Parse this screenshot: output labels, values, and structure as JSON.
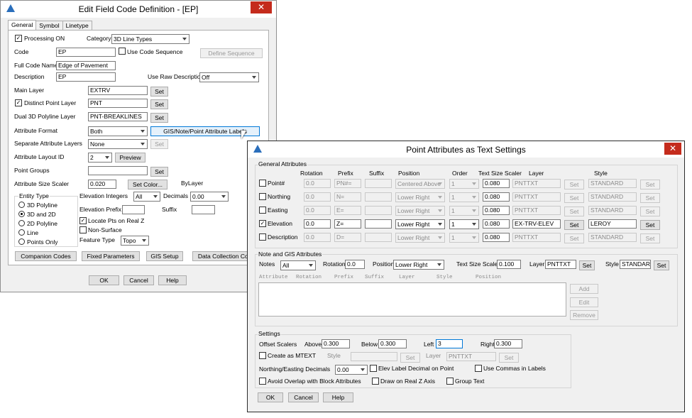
{
  "w1": {
    "title": "Edit Field Code Definition - [EP]",
    "close": "✕",
    "tabs": [
      "General",
      "Symbol",
      "Linetype"
    ],
    "processing_on": "Processing ON",
    "category_label": "Category",
    "category_value": "3D Line Types",
    "code_label": "Code",
    "code_value": "EP",
    "use_code_seq": "Use Code Sequence",
    "define_seq": "Define Sequence",
    "full_code_label": "Full Code Name",
    "full_code_value": "Edge of Pavement",
    "desc_label": "Description",
    "desc_value": "EP",
    "use_raw_label": "Use Raw Description",
    "use_raw_value": "Off",
    "main_layer_label": "Main Layer",
    "main_layer_value": "EXTRV",
    "distinct_label": "Distinct Point Layer",
    "distinct_value": "PNT",
    "dual_label": "Dual 3D Polyline Layer",
    "dual_value": "PNT-BREAKLINES",
    "attr_format_label": "Attribute Format",
    "attr_format_value": "Both",
    "gis_labels_btn": "GIS/Note/Point Attribute Labels",
    "sep_attr_label": "Separate Attribute Layers",
    "sep_attr_value": "None",
    "attr_layout_label": "Attribute Layout ID",
    "attr_layout_value": "2",
    "preview": "Preview",
    "point_groups_label": "Point Groups",
    "point_groups_value": "",
    "attr_size_label": "Attribute Size Scaler",
    "attr_size_value": "0.020",
    "set_color": "Set Color...",
    "bylayer": "ByLayer",
    "set": "Set",
    "entity_type": "Entity Type",
    "entity_options": [
      "3D Polyline",
      "3D and 2D",
      "2D Polyline",
      "Line",
      "Points Only"
    ],
    "elev_int_label": "Elevation Integers",
    "elev_int_value": "All",
    "decimals_label": "Decimals",
    "decimals_value": "0.00",
    "elev_prefix_label": "Elevation Prefix",
    "elev_prefix_value": "",
    "suffix_label": "Suffix",
    "suffix_value": "",
    "locate_pts": "Locate Pts on Real Z",
    "non_surface": "Non-Surface",
    "feature_type_label": "Feature Type",
    "feature_type_value": "Topo",
    "bottom_buttons": [
      "Companion Codes",
      "Fixed Parameters",
      "GIS Setup",
      "Data Collection Code"
    ],
    "ok": "OK",
    "cancel": "Cancel",
    "help": "Help"
  },
  "w2": {
    "title": "Point Attributes as Text Settings",
    "close": "✕",
    "general_attrs": "General Attributes",
    "headers": [
      "Rotation",
      "Prefix",
      "Suffix",
      "Position",
      "Order",
      "Text Size Scaler",
      "Layer",
      "Style"
    ],
    "rows": [
      {
        "name": "Point#",
        "checked": false,
        "rotation": "0.0",
        "prefix": "PN#=",
        "suffix": "",
        "position": "Centered Above",
        "order": "1",
        "size": "0.080",
        "layer": "PNTTXT",
        "style": "STANDARD"
      },
      {
        "name": "Northing",
        "checked": false,
        "rotation": "0.0",
        "prefix": "N=",
        "suffix": "",
        "position": "Lower Right",
        "order": "1",
        "size": "0.080",
        "layer": "PNTTXT",
        "style": "STANDARD"
      },
      {
        "name": "Easting",
        "checked": false,
        "rotation": "0.0",
        "prefix": "E=",
        "suffix": "",
        "position": "Lower Right",
        "order": "1",
        "size": "0.080",
        "layer": "PNTTXT",
        "style": "STANDARD"
      },
      {
        "name": "Elevation",
        "checked": true,
        "rotation": "0.0",
        "prefix": "Z=",
        "suffix": "",
        "position": "Lower Right",
        "order": "1",
        "size": "0.080",
        "layer": "EX-TRV-ELEV",
        "style": "LEROY"
      },
      {
        "name": "Description",
        "checked": false,
        "rotation": "0.0",
        "prefix": "D=",
        "suffix": "",
        "position": "Lower Right",
        "order": "1",
        "size": "0.080",
        "layer": "PNTTXT",
        "style": "STANDARD"
      }
    ],
    "set": "Set",
    "note_gis": "Note and GIS Attributes",
    "notes_label": "Notes",
    "notes_value": "All",
    "rotation_label": "Rotation",
    "rotation_value": "0.0",
    "position_label": "Position",
    "position_value": "Lower Right",
    "tss_label": "Text Size Scaler",
    "tss_value": "0.100",
    "layer_label": "Layer",
    "layer_value": "PNTTXT",
    "style_label": "Style",
    "style_value": "STANDARD",
    "list_headers": [
      "Attribute",
      "Rotation",
      "Prefix",
      "Suffix",
      "Layer",
      "Style",
      "Position"
    ],
    "add": "Add",
    "edit": "Edit",
    "remove": "Remove",
    "settings": "Settings",
    "offset_label": "Offset Scalers",
    "above_label": "Above",
    "above_value": "0.300",
    "below_label": "Below",
    "below_value": "0.300",
    "left_label": "Left",
    "left_value": "3",
    "right_label": "Right",
    "right_value": "0.300",
    "create_mtext": "Create as MTEXT",
    "style_dis": "Style",
    "layer_dis": "Layer",
    "layer_dis_value": "PNTTXT",
    "ne_decimals_label": "Northing/Easting Decimals",
    "ne_decimals_value": "0.00",
    "elev_label_dec": "Elev Label Decimal on Point",
    "use_commas": "Use Commas in Labels",
    "avoid_overlap": "Avoid Overlap with Block Attributes",
    "draw_real_z": "Draw on Real Z Axis",
    "group_text": "Group Text",
    "ok": "OK",
    "cancel": "Cancel",
    "help": "Help"
  }
}
